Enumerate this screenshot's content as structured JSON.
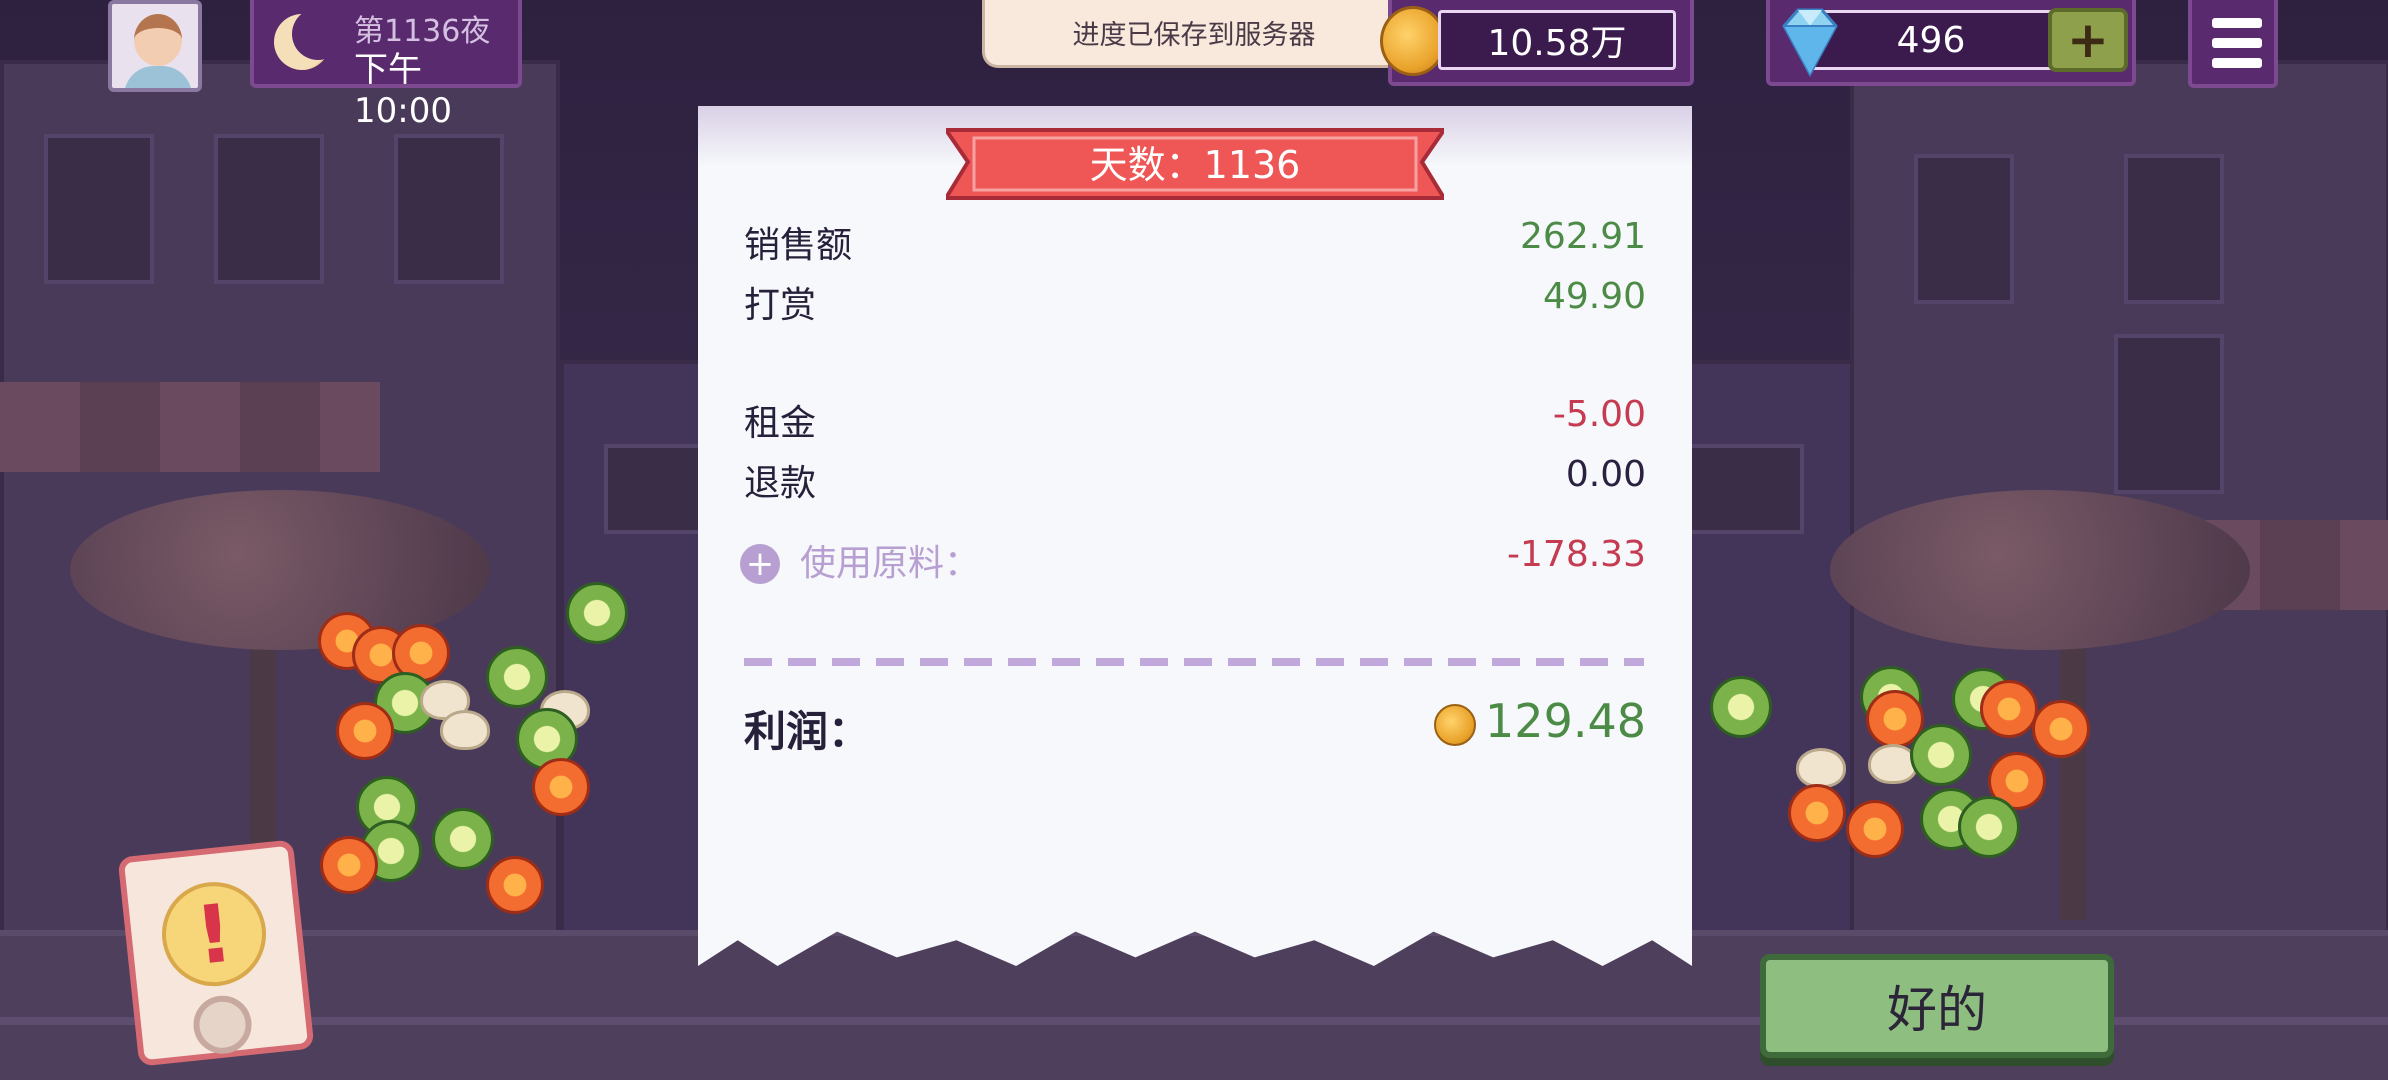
{
  "hud": {
    "day_label": "第1136夜",
    "time_label": "下午10:00",
    "toast": "进度已保存到服务器",
    "coins": "10.58万",
    "gems": "496",
    "gem_plus": "+"
  },
  "receipt": {
    "ribbon": "天数：1136",
    "rows": [
      {
        "label": "销售额",
        "value": "262.91"
      },
      {
        "label": "打赏",
        "value": "49.90"
      },
      {
        "label": "租金",
        "value": "-5.00"
      },
      {
        "label": "退款",
        "value": "0.00"
      }
    ],
    "materials": {
      "icon": "+",
      "label": "使用原料：",
      "value": "-178.33"
    },
    "profit": {
      "label": "利润：",
      "value": "129.48"
    }
  },
  "alert": {
    "symbol": "!"
  },
  "ok_button": "好的",
  "colors": {
    "hud_purple": "#5a2a6e",
    "income_green": "#4c8b46",
    "expense_red": "#c43b52",
    "ribbon_red": "#ef5656",
    "ok_green": "#8fbf80"
  }
}
